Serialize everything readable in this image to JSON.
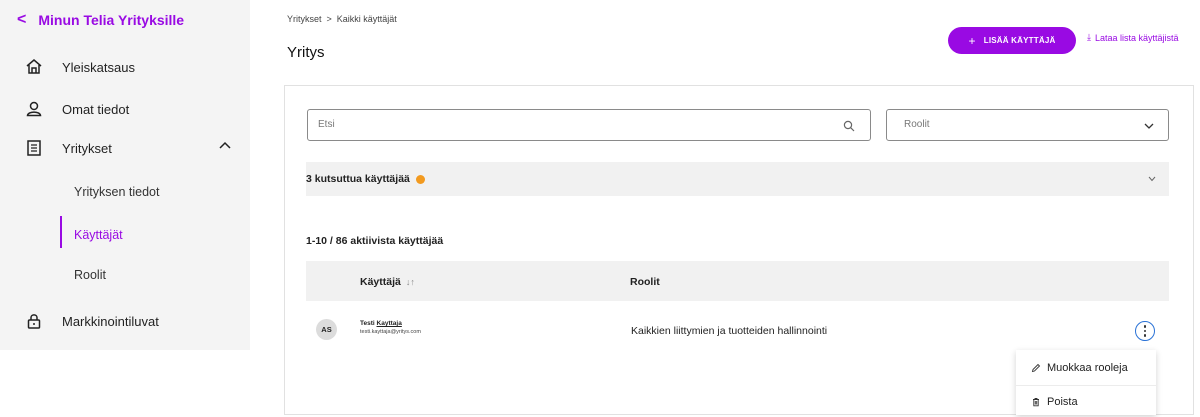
{
  "sidebar": {
    "back_label": "Minun Telia Yrityksille",
    "items": [
      {
        "label": "Yleiskatsaus",
        "icon": "home-icon"
      },
      {
        "label": "Omat tiedot",
        "icon": "user-icon"
      },
      {
        "label": "Yritykset",
        "icon": "company-icon"
      },
      {
        "label": "Markkinointiluvat",
        "icon": "lock-icon"
      }
    ],
    "subitems": [
      {
        "label": "Yrityksen tiedot"
      },
      {
        "label": "Käyttäjät",
        "active": true
      },
      {
        "label": "Roolit"
      }
    ]
  },
  "breadcrumb": {
    "items": [
      "Yritykset",
      "Kaikki käyttäjät"
    ],
    "separator": ">"
  },
  "header": {
    "title": "Yritys",
    "add_user_label": "LISÄÄ KÄYTTÄJÄ",
    "download_label": "Lataa lista käyttäjistä"
  },
  "filters": {
    "search_placeholder": "Etsi",
    "roles_placeholder": "Roolit"
  },
  "invited": {
    "label": "3 kutsuttua käyttäjää"
  },
  "table": {
    "count_label": "1-10 / 86 aktiivista käyttäjää",
    "columns": [
      "Käyttäjä",
      "Roolit"
    ],
    "rows": [
      {
        "initials": "AS",
        "first_name": "Testi",
        "last_name": "Kayttaja",
        "email": "testi.kayttaja@yritys.com",
        "roles": "Kaikkien liittymien ja tuotteiden hallinnointi"
      }
    ]
  },
  "menu": {
    "items": [
      "Muokkaa rooleja",
      "Poista"
    ]
  },
  "colors": {
    "accent": "#990ae3",
    "warning_dot": "#f29a1f",
    "focus": "#2a72d6"
  }
}
